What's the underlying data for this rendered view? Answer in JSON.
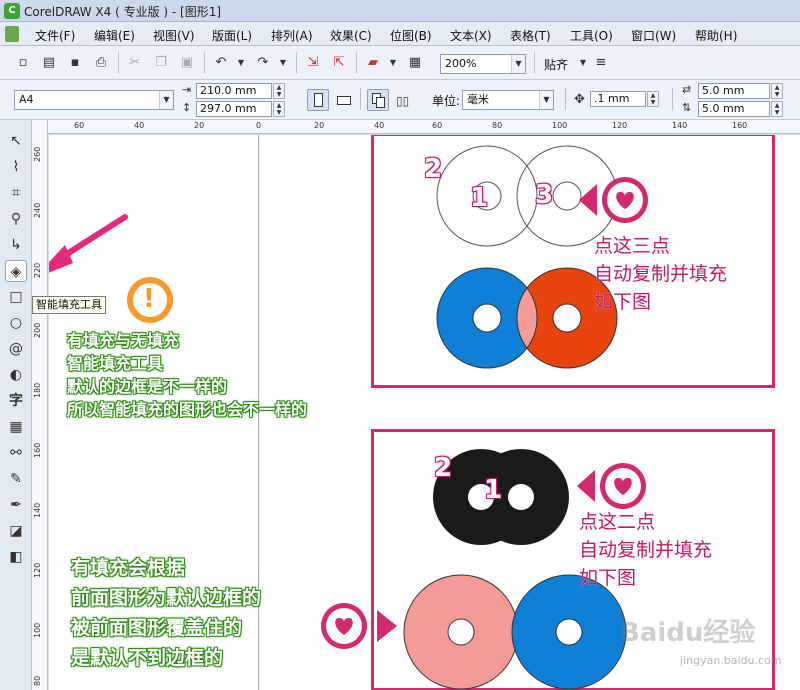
{
  "window": {
    "title": "CorelDRAW X4 ( 专业版 ) - [图形1]"
  },
  "menu": [
    "文件(F)",
    "编辑(E)",
    "视图(V)",
    "版面(L)",
    "排列(A)",
    "效果(C)",
    "位图(B)",
    "文本(X)",
    "表格(T)",
    "工具(O)",
    "窗口(W)",
    "帮助(H)"
  ],
  "toolbar": {
    "zoom": "200%",
    "snap": "贴齐"
  },
  "propbar": {
    "paper": "A4",
    "width": "210.0 mm",
    "height": "297.0 mm",
    "unit_label": "单位:",
    "unit": "毫米",
    "nudge": ".1 mm",
    "dup_x": "5.0 mm",
    "dup_y": "5.0 mm"
  },
  "rulers": {
    "horizontal": [
      "60",
      "40",
      "20",
      "0",
      "20",
      "40",
      "60",
      "80",
      "100",
      "120",
      "140",
      "160"
    ],
    "vertical": [
      "260",
      "240",
      "220",
      "200",
      "180",
      "160",
      "140",
      "120",
      "100",
      "80"
    ]
  },
  "tooltip": "智能填充工具",
  "notes": {
    "note1": [
      "有填充与无填充",
      "智能填充工具",
      "默认的边框是不一样的",
      "所以智能填充的图形也会不一样的"
    ],
    "note2": [
      "有填充会根据",
      "前面图形为默认边框的",
      "被前面图形覆盖住的",
      "是默认不到边框的"
    ],
    "panel1_text": [
      "点这三点",
      "自动复制并填充",
      "如下图"
    ],
    "panel2_text": [
      "点这二点",
      "自动复制并填充",
      "如下图"
    ],
    "warning_mark": "!"
  },
  "panel1": {
    "markers": [
      "2",
      "1",
      "3"
    ]
  },
  "panel2": {
    "markers": [
      "2",
      "1"
    ]
  },
  "watermark": {
    "brand": "Baidu经验",
    "url": "jingyan.baidu.com"
  },
  "colors": {
    "accent": "#d32a6f",
    "blue": "#0f80d8",
    "red_orange": "#e8450e",
    "salmon": "#f39b97",
    "black": "#1a1a1a"
  }
}
